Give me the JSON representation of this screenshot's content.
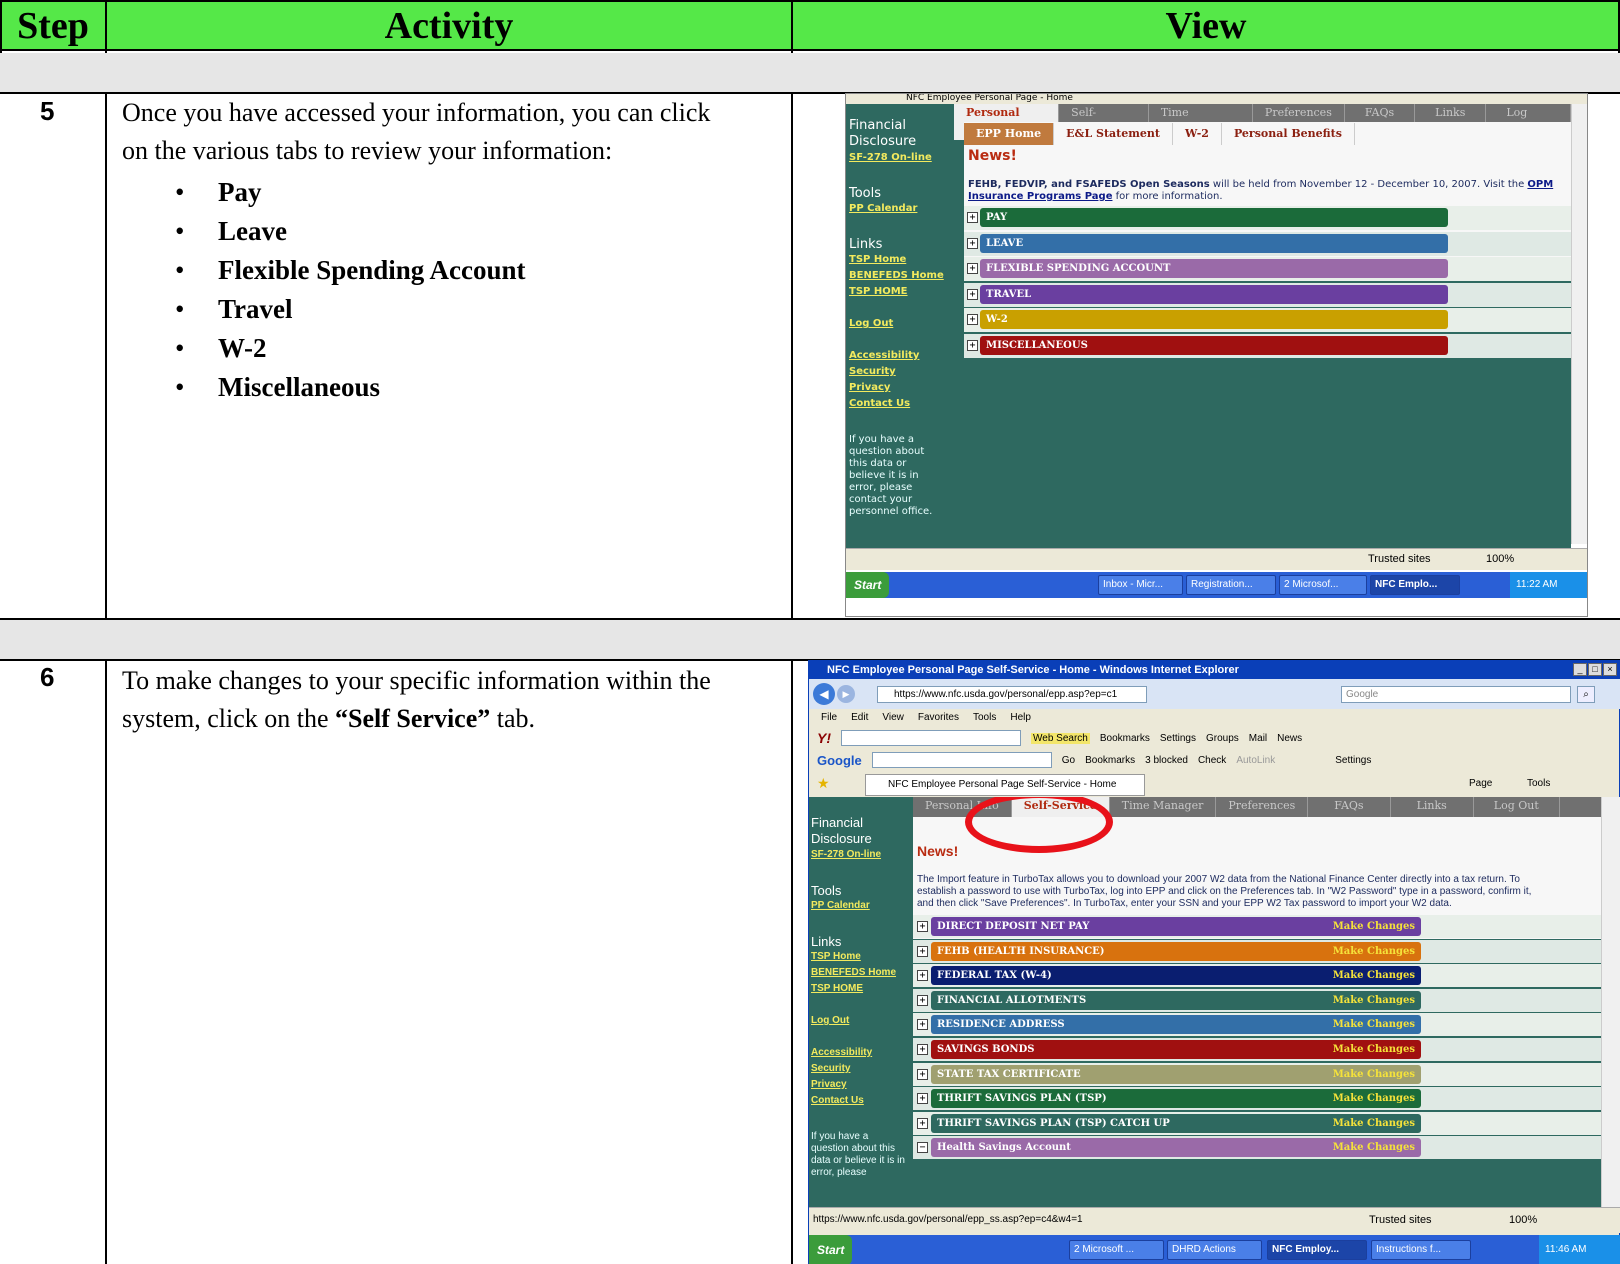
{
  "header": {
    "step": "Step",
    "activity": "Activity",
    "view": "View"
  },
  "row5": {
    "step": "5",
    "intro": "Once you have accessed your information, you can click on the various tabs to review your information:",
    "bullets": [
      "Pay",
      "Leave",
      "Flexible Spending Account",
      "Travel",
      "W-2",
      "Miscellaneous"
    ]
  },
  "row6": {
    "step": "6",
    "text_before": "To make changes to your specific information within the system, click on the ",
    "text_bold": "“Self Service”",
    "text_after": " tab."
  },
  "shot1": {
    "page_title": "NFC Employee Personal Page - Home",
    "tabs": [
      "Personal Info",
      "Self-Service",
      "Time Manager",
      "Preferences",
      "FAQs",
      "Links",
      "Log Out"
    ],
    "subtabs": [
      "EPP Home",
      "E&L Statement",
      "W-2",
      "Personal Benefits"
    ],
    "news_title": "News!",
    "news_bold": "FEHB, FEDVIP, and FSAFEDS Open Seasons",
    "news_mid": " will be held from November 12 - December 10, 2007. Visit the ",
    "news_link": "OPM Insurance Programs Page",
    "news_end": " for more information.",
    "bars": [
      {
        "label": "PAY",
        "color": "#1b6b3a"
      },
      {
        "label": "LEAVE",
        "color": "#336fa8"
      },
      {
        "label": "FLEXIBLE SPENDING ACCOUNT",
        "color": "#9a6aa8"
      },
      {
        "label": "TRAVEL",
        "color": "#6a3fa0"
      },
      {
        "label": "W-2",
        "color": "#c9a000"
      },
      {
        "label": "MISCELLANEOUS",
        "color": "#a01010"
      }
    ],
    "status": {
      "zone": "Trusted sites",
      "zoom": "100%"
    },
    "taskbar": {
      "start": "Start",
      "buttons": [
        "Inbox - Micr...",
        "Registration...",
        "2 Microsof...",
        "NFC Emplo..."
      ],
      "time": "11:22 AM"
    }
  },
  "sidebar": {
    "financial": "Financial Disclosure",
    "sf278": "SF-278 On-line",
    "tools": "Tools",
    "ppcal": "PP Calendar",
    "links": "Links",
    "tsp": "TSP Home",
    "benefeds": "BENEFEDS Home",
    "tsp2": "TSP HOME",
    "logout": "Log Out",
    "access": "Accessibility",
    "security": "Security",
    "privacy": "Privacy",
    "contact": "Contact Us",
    "note": "If you have a question about this data or believe it is in error, please contact your personnel office.",
    "note_short": "If you have a question about this data or believe it is in error, please"
  },
  "shot2": {
    "window_title": "NFC Employee Personal Page Self-Service - Home - Windows Internet Explorer",
    "url": "https://www.nfc.usda.gov/personal/epp.asp?ep=c1",
    "search_placeholder": "Google",
    "menu": [
      "File",
      "Edit",
      "View",
      "Favorites",
      "Tools",
      "Help"
    ],
    "yahoo_toolbar": [
      "Web Search",
      "Bookmarks",
      "Settings",
      "Groups",
      "Mail",
      "News"
    ],
    "google_toolbar": [
      "Go",
      "Bookmarks",
      "3 blocked",
      "Check",
      "AutoLink",
      "Settings"
    ],
    "tab_title": "NFC Employee Personal Page Self-Service - Home",
    "cmd": [
      "Page",
      "Tools"
    ],
    "tabs": [
      "Personal Info",
      "Self-Service",
      "Time Manager",
      "Preferences",
      "FAQs",
      "Links",
      "Log Out"
    ],
    "news_title": "News!",
    "news_text": "The Import feature in TurboTax allows you to download your 2007 W2 data from the National Finance Center directly into a tax return. To establish a password to use with TurboTax, log into EPP and click on the Preferences tab. In \"W2 Password\" type in a password, confirm it, and then click \"Save Preferences\". In TurboTax, enter your SSN and your EPP W2 Tax password to import your W2 data.",
    "make_changes": "Make Changes",
    "bars": [
      {
        "label": "DIRECT DEPOSIT NET PAY",
        "color": "#6a3fa0"
      },
      {
        "label": "FEHB (HEALTH INSURANCE)",
        "color": "#d8720e"
      },
      {
        "label": "FEDERAL TAX (W-4)",
        "color": "#0a1e70"
      },
      {
        "label": "FINANCIAL ALLOTMENTS",
        "color": "#2e6960"
      },
      {
        "label": "RESIDENCE ADDRESS",
        "color": "#336fa8"
      },
      {
        "label": "SAVINGS BONDS",
        "color": "#a01010"
      },
      {
        "label": "STATE TAX CERTIFICATE",
        "color": "#a0a070"
      },
      {
        "label": "THRIFT SAVINGS PLAN (TSP)",
        "color": "#1b6b3a"
      },
      {
        "label": "THRIFT SAVINGS PLAN (TSP) CATCH UP",
        "color": "#2e6960"
      },
      {
        "label": "Health Savings Account",
        "color": "#9a6aa8"
      }
    ],
    "status_url": "https://www.nfc.usda.gov/personal/epp_ss.asp?ep=c4&w4=1",
    "status": {
      "zone": "Trusted sites",
      "zoom": "100%"
    },
    "taskbar": {
      "start": "Start",
      "buttons": [
        "2 Microsoft ...",
        "DHRD Actions",
        "NFC Employ...",
        "Instructions f..."
      ],
      "time": "11:46 AM"
    }
  }
}
